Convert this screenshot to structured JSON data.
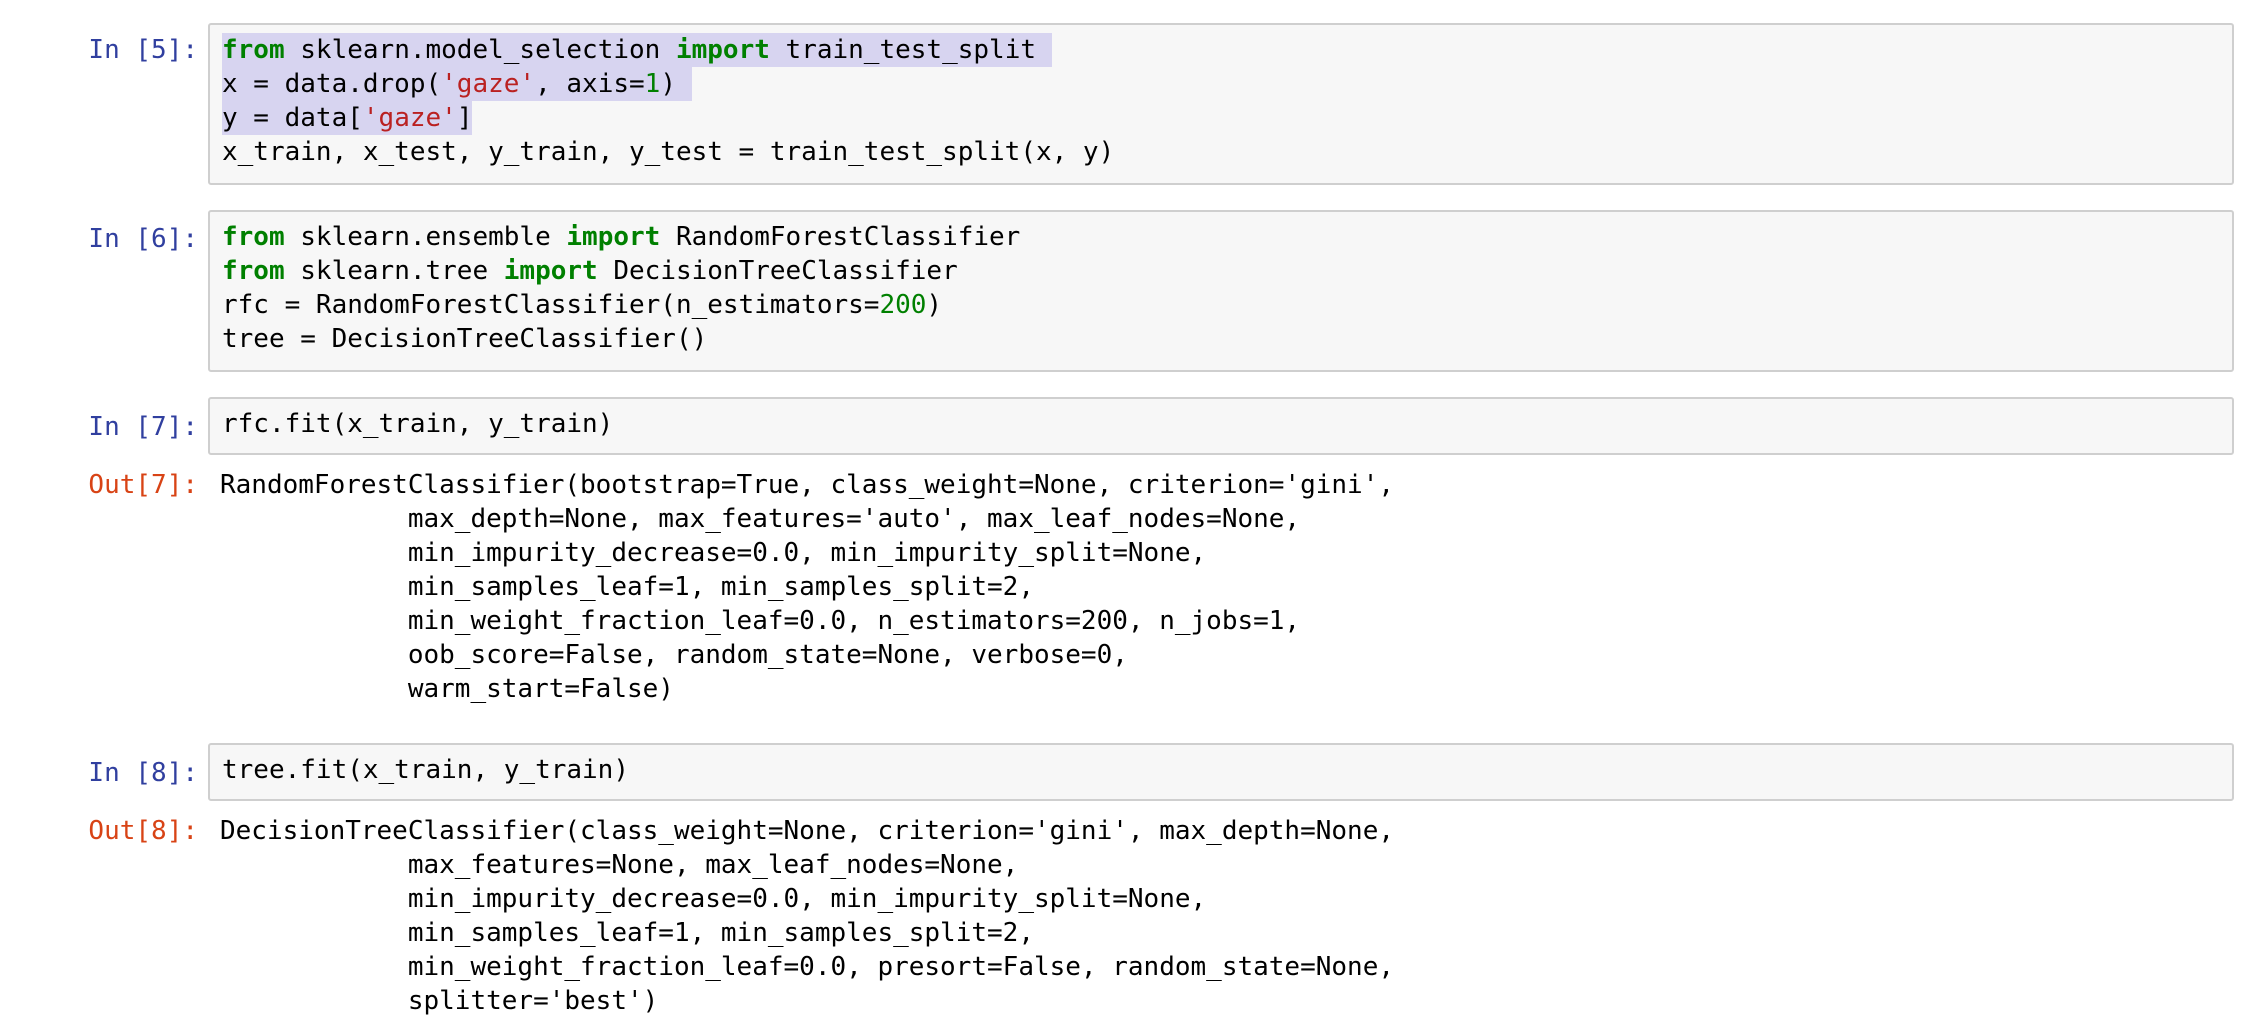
{
  "colors": {
    "prompt_in": "#303f9f",
    "prompt_out": "#d84315",
    "keyword": "#008000",
    "string": "#ba2121",
    "number": "#008000",
    "cell_background": "#f7f7f7",
    "cell_border": "#cfcfcf",
    "selection": "#d7d4f0"
  },
  "cells": [
    {
      "in_prompt": "In [5]:",
      "code_lines": [
        [
          {
            "t": "from",
            "k": "kw"
          },
          {
            "t": " sklearn.model_selection "
          },
          {
            "t": "import",
            "k": "kw"
          },
          {
            "t": " train_test_split "
          }
        ],
        [
          {
            "t": "x = data.drop("
          },
          {
            "t": "'gaze'",
            "k": "str"
          },
          {
            "t": ", axis="
          },
          {
            "t": "1",
            "k": "num"
          },
          {
            "t": ") "
          }
        ],
        [
          {
            "t": "y = data["
          },
          {
            "t": "'gaze'",
            "k": "str"
          },
          {
            "t": "]"
          }
        ],
        [
          {
            "t": "x_train, x_test, y_train, y_test = train_test_split(x, y)"
          }
        ]
      ],
      "selected_lines": 3
    },
    {
      "in_prompt": "In [6]:",
      "code_lines": [
        [
          {
            "t": "from",
            "k": "kw"
          },
          {
            "t": " sklearn.ensemble "
          },
          {
            "t": "import",
            "k": "kw"
          },
          {
            "t": " RandomForestClassifier"
          }
        ],
        [
          {
            "t": "from",
            "k": "kw"
          },
          {
            "t": " sklearn.tree "
          },
          {
            "t": "import",
            "k": "kw"
          },
          {
            "t": " DecisionTreeClassifier"
          }
        ],
        [
          {
            "t": "rfc = RandomForestClassifier(n_estimators="
          },
          {
            "t": "200",
            "k": "num"
          },
          {
            "t": ")"
          }
        ],
        [
          {
            "t": "tree = DecisionTreeClassifier()"
          }
        ]
      ],
      "selected_lines": 0
    },
    {
      "in_prompt": "In [7]:",
      "code_lines": [
        [
          {
            "t": "rfc.fit(x_train, y_train)"
          }
        ]
      ],
      "selected_lines": 0,
      "out_prompt": "Out[7]:",
      "output_lines": [
        "RandomForestClassifier(bootstrap=True, class_weight=None, criterion='gini',",
        "            max_depth=None, max_features='auto', max_leaf_nodes=None,",
        "            min_impurity_decrease=0.0, min_impurity_split=None,",
        "            min_samples_leaf=1, min_samples_split=2,",
        "            min_weight_fraction_leaf=0.0, n_estimators=200, n_jobs=1,",
        "            oob_score=False, random_state=None, verbose=0,",
        "            warm_start=False)"
      ]
    },
    {
      "in_prompt": "In [8]:",
      "code_lines": [
        [
          {
            "t": "tree.fit(x_train, y_train)"
          }
        ]
      ],
      "selected_lines": 0,
      "out_prompt": "Out[8]:",
      "output_lines": [
        "DecisionTreeClassifier(class_weight=None, criterion='gini', max_depth=None,",
        "            max_features=None, max_leaf_nodes=None,",
        "            min_impurity_decrease=0.0, min_impurity_split=None,",
        "            min_samples_leaf=1, min_samples_split=2,",
        "            min_weight_fraction_leaf=0.0, presort=False, random_state=None,",
        "            splitter='best')"
      ]
    }
  ]
}
